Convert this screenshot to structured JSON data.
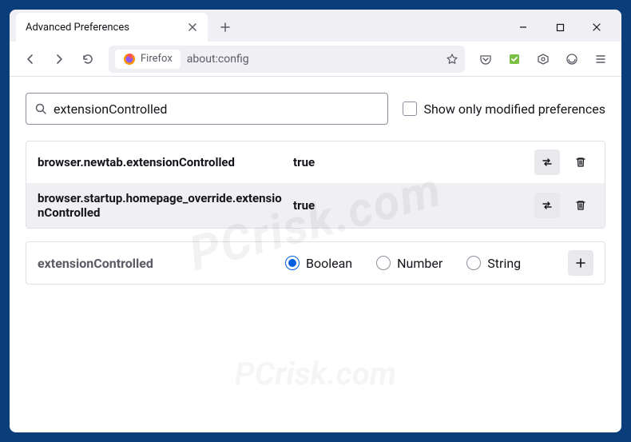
{
  "tab": {
    "title": "Advanced Preferences"
  },
  "urlbar": {
    "identity": "Firefox",
    "url": "about:config"
  },
  "search": {
    "value": "extensionControlled",
    "show_modified_label": "Show only modified preferences"
  },
  "prefs": [
    {
      "name": "browser.newtab.extensionControlled",
      "value": "true"
    },
    {
      "name": "browser.startup.homepage_override.extensionControlled",
      "value": "true"
    }
  ],
  "newpref": {
    "name": "extensionControlled",
    "types": {
      "boolean": "Boolean",
      "number": "Number",
      "string": "String"
    },
    "selected": "boolean"
  },
  "watermark": {
    "main": "PCrisk.com",
    "sub": "PCrisk.com"
  }
}
